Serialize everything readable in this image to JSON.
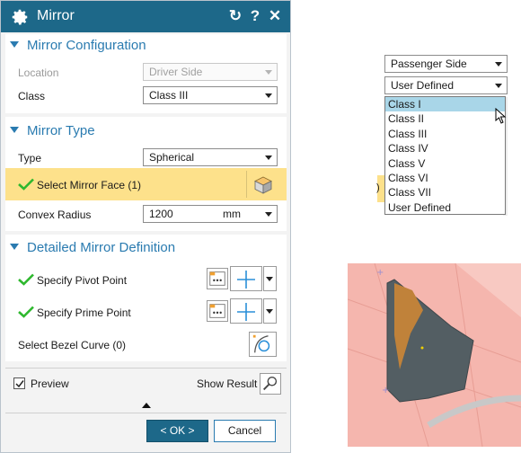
{
  "dialog": {
    "title": "Mirror",
    "icons": {
      "settings": "gear-icon",
      "reset": "reset-icon",
      "help": "help-icon",
      "close": "close-icon"
    },
    "help_label": "?",
    "close_label": "✕",
    "reset_label": "↻",
    "sections": {
      "config": {
        "title": "Mirror Configuration",
        "location_label": "Location",
        "location_value": "Driver Side",
        "class_label": "Class",
        "class_value": "Class III"
      },
      "type": {
        "title": "Mirror Type",
        "type_label": "Type",
        "type_value": "Spherical",
        "select_face_label": "Select Mirror Face (1)",
        "convex_radius_label": "Convex Radius",
        "convex_radius_value": "1200",
        "convex_radius_unit": "mm"
      },
      "detailed": {
        "title": "Detailed Mirror Definition",
        "pivot_label": "Specify Pivot Point",
        "prime_label": "Specify Prime Point",
        "bezel_label": "Select Bezel Curve (0)"
      }
    },
    "preview_label": "Preview",
    "preview_checked": true,
    "show_result_label": "Show Result",
    "ok_label": "< OK >",
    "cancel_label": "Cancel"
  },
  "dropdown_panel": {
    "location_value": "Passenger Side",
    "class_value": "User Defined",
    "options": [
      "Class I",
      "Class II",
      "Class III",
      "Class IV",
      "Class V",
      "Class VI",
      "Class VII",
      "User Defined"
    ],
    "highlighted_option": "Class I"
  },
  "colors": {
    "titlebar": "#1d6889",
    "section_title": "#2a7bb0",
    "highlight": "#fde18b",
    "check": "#2eb82e",
    "mirror_face": "#c0823a",
    "mirror_body": "#535e63",
    "background_surface": "#f5b6ae"
  }
}
